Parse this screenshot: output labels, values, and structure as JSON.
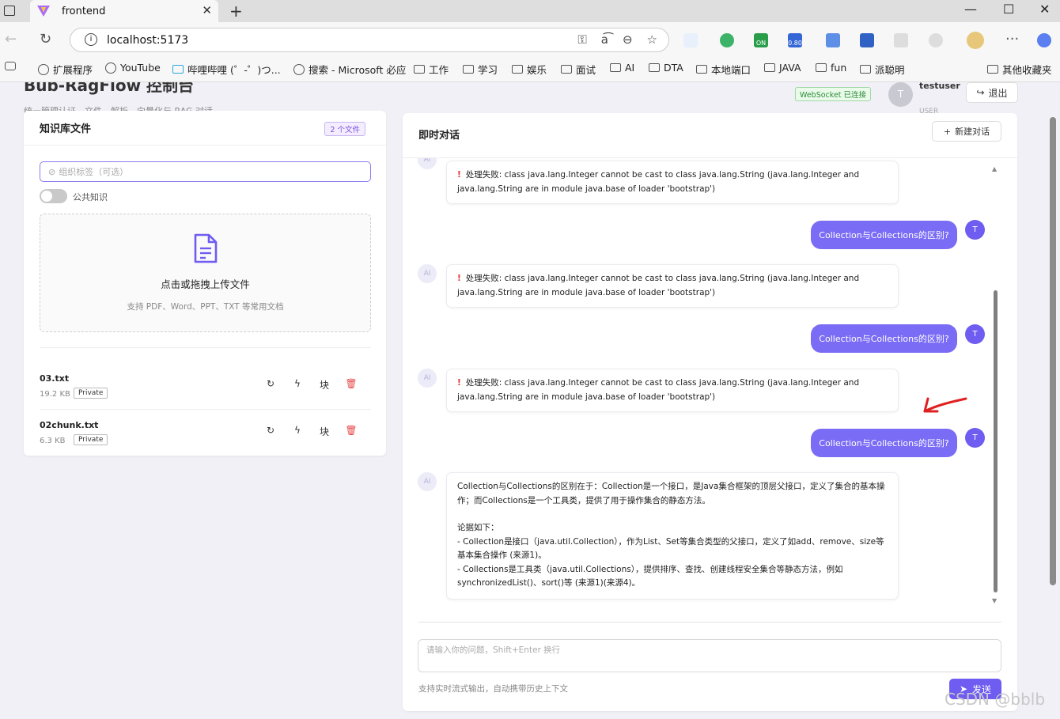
{
  "browser": {
    "tab_title": "frontend",
    "url": "localhost:5173",
    "bookmarks": [
      "扩展程序",
      "YouTube",
      "哔哩哔哩 (゜-゜)つ...",
      "搜索 - Microsoft 必应",
      "工作",
      "学习",
      "娱乐",
      "面试",
      "AI",
      "DTA",
      "本地端口",
      "JAVA",
      "fun",
      "派聪明",
      "其他收藏夹"
    ],
    "ext_badge": "0.80",
    "ext_on": "ON"
  },
  "header": {
    "title": "Bub-RagFlow 控制台",
    "subtitle": "统一管理认证、文件、解析、向量化与 RAG 对话",
    "ws_status": "WebSocket 已连接",
    "avatar_letter": "T",
    "username": "testuser",
    "role": "USER",
    "logout_label": "退出"
  },
  "knowledge": {
    "title": "知识库文件",
    "count_badge": "2 个文件",
    "tag_placeholder": "组织标签（可选）",
    "public_label": "公共知识",
    "upload_title": "点击或拖拽上传文件",
    "upload_hint": "支持 PDF、Word、PPT、TXT 等常用文档",
    "files": [
      {
        "name": "03.txt",
        "size": "19.2 KB",
        "scope": "Private",
        "chunk_label": "块"
      },
      {
        "name": "02chunk.txt",
        "size": "6.3 KB",
        "scope": "Private",
        "chunk_label": "块"
      }
    ]
  },
  "chat": {
    "title": "即时对话",
    "new_chat_label": "新建对话",
    "ai_label": "AI",
    "user_letter": "T",
    "messages": [
      {
        "role": "ai",
        "error": true,
        "text": "处理失败: class java.lang.Integer cannot be cast to class java.lang.String (java.lang.Integer and java.lang.String are in module java.base of loader 'bootstrap')"
      },
      {
        "role": "user",
        "text": "Collection与Collections的区别?"
      },
      {
        "role": "ai",
        "error": true,
        "text": "处理失败: class java.lang.Integer cannot be cast to class java.lang.String (java.lang.Integer and java.lang.String are in module java.base of loader 'bootstrap')"
      },
      {
        "role": "user",
        "text": "Collection与Collections的区别?"
      },
      {
        "role": "ai",
        "error": true,
        "text": "处理失败: class java.lang.Integer cannot be cast to class java.lang.String (java.lang.Integer and java.lang.String are in module java.base of loader 'bootstrap')"
      },
      {
        "role": "user",
        "text": "Collection与Collections的区别?"
      },
      {
        "role": "ai",
        "error": false,
        "lines": [
          "Collection与Collections的区别在于：Collection是一个接口，是Java集合框架的顶层父接口，定义了集合的基本操作；而Collections是一个工具类，提供了用于操作集合的静态方法。",
          "",
          "论据如下：",
          "- Collection是接口（java.util.Collection），作为List、Set等集合类型的父接口，定义了如add、remove、size等基本集合操作 (来源1)。",
          "- Collections是工具类（java.util.Collections），提供排序、查找、创建线程安全集合等静态方法，例如synchronizedList()、sort()等 (来源1)(来源4)。"
        ]
      }
    ],
    "input_placeholder": "请输入你的问题，Shift+Enter 换行",
    "hint": "支持实时流式输出，自动携带历史上下文",
    "send_label": "发送"
  },
  "watermark": "CSDN @bblb",
  "colors": {
    "accent": "#6f5cf0",
    "user_bubble": "#7a6cf4",
    "error": "#e53030"
  }
}
